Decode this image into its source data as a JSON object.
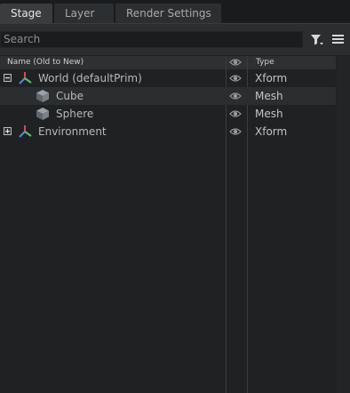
{
  "tabs": [
    {
      "label": "Stage",
      "active": true
    },
    {
      "label": "Layer",
      "active": false
    },
    {
      "label": "Render Settings",
      "active": false
    }
  ],
  "search": {
    "placeholder": "Search"
  },
  "columns": {
    "name": "Name (Old to New)",
    "type": "Type"
  },
  "tree": [
    {
      "label": "World (defaultPrim)",
      "type": "Xform",
      "icon": "xform-axes-icon",
      "expander": "collapse"
    },
    {
      "label": "Cube",
      "type": "Mesh",
      "icon": "mesh-cube-icon",
      "selected": true
    },
    {
      "label": "Sphere",
      "type": "Mesh",
      "icon": "mesh-cube-icon"
    },
    {
      "label": "Environment",
      "type": "Xform",
      "icon": "xform-axes-icon",
      "expander": "expand"
    }
  ],
  "colors": {
    "background": "#1f2123",
    "selected_row": "#2a2e30",
    "axis_x": "#d94a4a",
    "axis_y": "#5fc16a",
    "axis_z": "#4a8fe0"
  }
}
